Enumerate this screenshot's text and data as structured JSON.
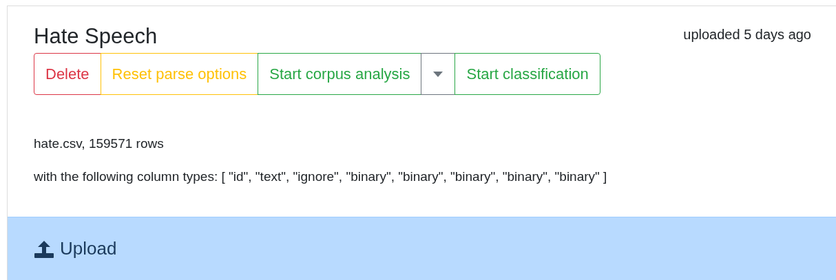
{
  "card": {
    "title": "Hate Speech",
    "uploaded": "uploaded 5 days ago",
    "buttons": [
      {
        "kind": "button",
        "label": "Delete",
        "color": "#dc3545"
      },
      {
        "kind": "button",
        "label": "Reset parse options",
        "color": "#ffc107"
      },
      {
        "kind": "button",
        "label": "Start corpus analysis",
        "color": "#28a745"
      },
      {
        "kind": "toggle",
        "color": "#6c757d"
      },
      {
        "kind": "button",
        "label": "Start classification",
        "color": "#28a745"
      }
    ],
    "file_info": "hate.csv, 159571 rows",
    "column_types": "with the following column types: [ \"id\", \"text\", \"ignore\", \"binary\", \"binary\", \"binary\", \"binary\", \"binary\" ]"
  },
  "upload": {
    "label": "Upload"
  }
}
